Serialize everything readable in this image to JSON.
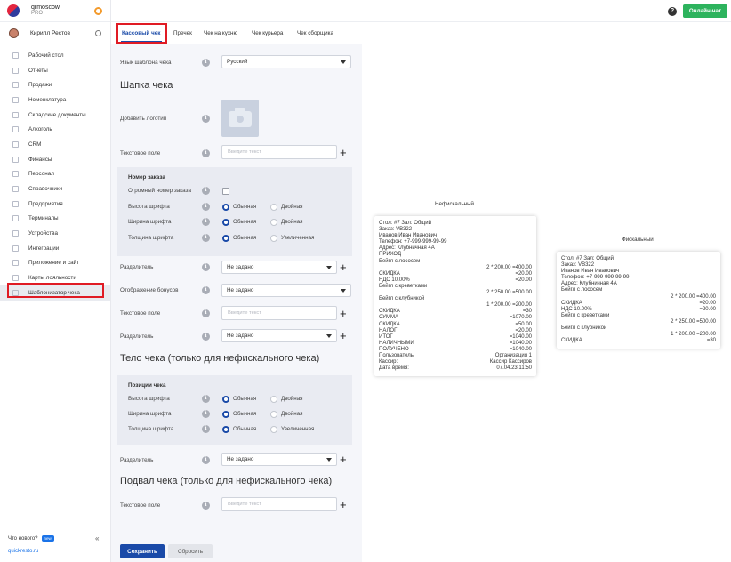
{
  "app": {
    "brand_name": "qrmoscow",
    "brand_plan": "PRO",
    "user_name": "Кирилл Рестов"
  },
  "topbar": {
    "help_label": "?",
    "online_chat_label": "Онлайн-чат"
  },
  "sidebar": {
    "items": [
      {
        "label": "Рабочий стол",
        "icon": "desktop-icon"
      },
      {
        "label": "Отчеты",
        "icon": "reports-icon"
      },
      {
        "label": "Продажи",
        "icon": "sales-icon"
      },
      {
        "label": "Номенклатура",
        "icon": "nomenclature-icon"
      },
      {
        "label": "Складские документы",
        "icon": "warehouse-icon"
      },
      {
        "label": "Алкоголь",
        "icon": "alcohol-icon"
      },
      {
        "label": "CRM",
        "icon": "crm-icon"
      },
      {
        "label": "Финансы",
        "icon": "finance-icon"
      },
      {
        "label": "Персонал",
        "icon": "staff-icon"
      },
      {
        "label": "Справочники",
        "icon": "reference-icon"
      },
      {
        "label": "Предприятия",
        "icon": "company-icon"
      },
      {
        "label": "Терминалы",
        "icon": "terminal-icon"
      },
      {
        "label": "Устройства",
        "icon": "printer-icon"
      },
      {
        "label": "Интеграции",
        "icon": "integration-icon"
      },
      {
        "label": "Приложение и сайт",
        "icon": "app-icon"
      },
      {
        "label": "Карты лояльности",
        "icon": "loyalty-card-icon"
      },
      {
        "label": "Шаблонизатор чека",
        "icon": "receipt-template-icon"
      }
    ],
    "whats_new": "Что нового?",
    "new_badge": "new",
    "collapse": "«",
    "footer_link": "quickresto.ru"
  },
  "tabs": [
    "Кассовый чек",
    "Пречек",
    "Чек на кухню",
    "Чек курьера",
    "Чек сборщика"
  ],
  "form": {
    "template_language_label": "Язык шаблона чека",
    "template_language_value": "Русский",
    "header_title": "Шапка чека",
    "add_logo_label": "Добавить логотип",
    "text_field_label": "Текстовое поле",
    "text_placeholder": "Введите текст",
    "order_number_group": "Номер заказа",
    "big_order_number_label": "Огромный номер заказа",
    "font_height_label": "Высота шрифта",
    "font_width_label": "Ширина шрифта",
    "font_weight_label": "Толщина шрифта",
    "normal": "Обычная",
    "double": "Двойная",
    "bold": "Увеличенная",
    "separator_label": "Разделитель",
    "not_set": "Не задано",
    "bonus_display_label": "Отображение бонусов",
    "body_title": "Тело чека (только для нефискального чека)",
    "positions_group": "Позиции чека",
    "footer_title": "Подвал чека (только для нефискального чека)",
    "info": "i"
  },
  "actions": {
    "save": "Сохранить",
    "reset": "Сбросить"
  },
  "preview": {
    "nonfiscal_title": "Нефискальный",
    "fiscal_title": "Фискальный",
    "nonfiscal_lines": [
      {
        "t": "l",
        "a": "Стол: #7 Зал: Общий"
      },
      {
        "t": "l",
        "a": "Заказ: VB322"
      },
      {
        "t": "l",
        "a": "Иванов Иван Иванович"
      },
      {
        "t": "l",
        "a": "Телефон: +7-999-999-99-99"
      },
      {
        "t": "l",
        "a": "Адрес: Клубничная 4А"
      },
      {
        "t": "l",
        "a": "ПРИХОД"
      },
      {
        "t": "l",
        "a": "Бейгл с лососем"
      },
      {
        "t": "r",
        "a": "2 * 200.00 =400.00"
      },
      {
        "t": "p",
        "a": "СКИДКА",
        "b": "=20.00"
      },
      {
        "t": "p",
        "a": "НДС 10.00%",
        "b": "=20.00"
      },
      {
        "t": "l",
        "a": "Бейгл с креветками"
      },
      {
        "t": "r",
        "a": "2 * 250.00 =500.00"
      },
      {
        "t": "l",
        "a": "Бейгл с клубникой"
      },
      {
        "t": "r",
        "a": "1 * 200.00 =200.00"
      },
      {
        "t": "p",
        "a": "СКИДКА",
        "b": "=30"
      },
      {
        "t": "p",
        "a": "СУММА",
        "b": "=1070.00"
      },
      {
        "t": "p",
        "a": "СКИДКА",
        "b": "=50.00"
      },
      {
        "t": "p",
        "a": "НАЛОГ",
        "b": "=20.00"
      },
      {
        "t": "p",
        "a": "ИТОГ",
        "b": "=1040.00"
      },
      {
        "t": "p",
        "a": "НАЛИЧНЫМИ",
        "b": "=1040.00"
      },
      {
        "t": "p",
        "a": "ПОЛУЧЕНО",
        "b": "=1040.00"
      },
      {
        "t": "p",
        "a": "Пользователь:",
        "b": "Организация 1"
      },
      {
        "t": "p",
        "a": "Кассир:",
        "b": "Кассир Кассиров"
      },
      {
        "t": "p",
        "a": "Дата время:",
        "b": "07.04.23 11:50"
      }
    ],
    "fiscal_lines": [
      {
        "t": "l",
        "a": "Стол: #7 Зал: Общий"
      },
      {
        "t": "l",
        "a": "Заказ: VB322"
      },
      {
        "t": "l",
        "a": "Иванов Иван Иванович"
      },
      {
        "t": "l",
        "a": "Телефон: +7-999-999-99-99"
      },
      {
        "t": "l",
        "a": "Адрес: Клубничная 4А"
      },
      {
        "t": "l",
        "a": "Бейгл с лососем"
      },
      {
        "t": "r",
        "a": "2 * 200.00 =400.00"
      },
      {
        "t": "p",
        "a": "СКИДКА",
        "b": "=20.00"
      },
      {
        "t": "p",
        "a": "НДС 10.00%",
        "b": "=20.00"
      },
      {
        "t": "l",
        "a": "Бейгл с креветками"
      },
      {
        "t": "r",
        "a": "2 * 250.00 =500.00"
      },
      {
        "t": "l",
        "a": "Бейгл с клубникой"
      },
      {
        "t": "r",
        "a": "1 * 200.00 =200.00"
      },
      {
        "t": "p",
        "a": "СКИДКА",
        "b": "=30"
      }
    ]
  }
}
